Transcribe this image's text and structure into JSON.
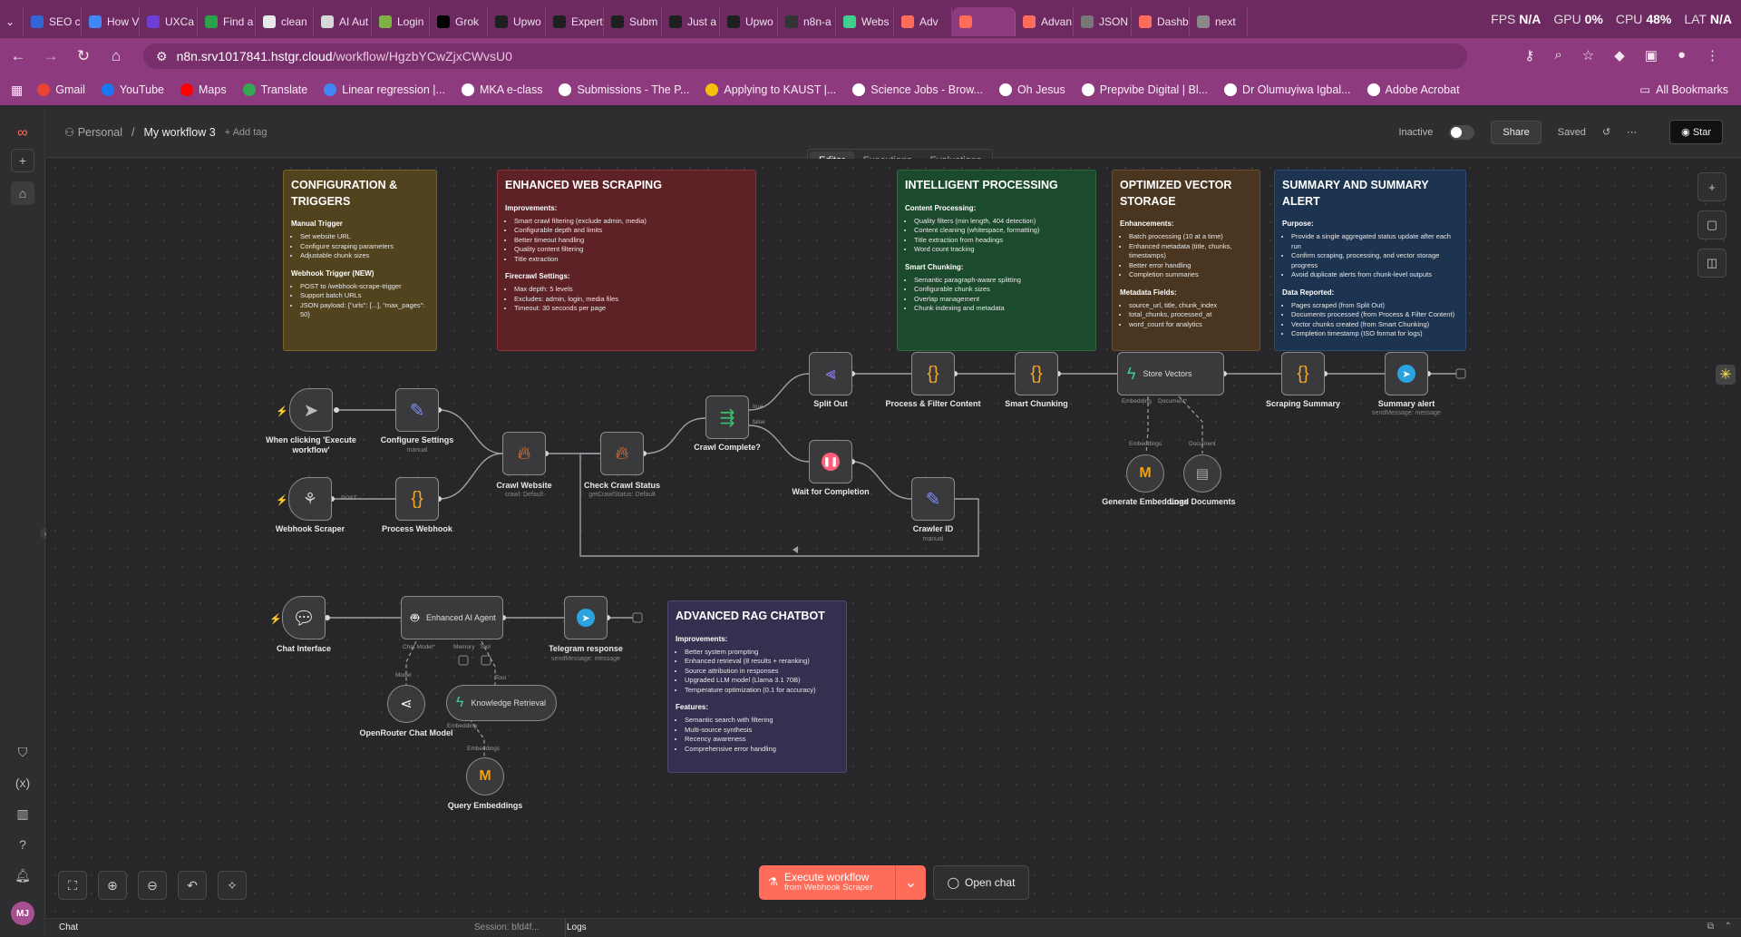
{
  "browser": {
    "tabs": [
      "SEO c",
      "How V",
      "UXCa",
      "Find a",
      "clean",
      "AI Aut",
      "Login",
      "Grok",
      "Upwo",
      "Expert",
      "Subm",
      "Just a",
      "Upwo",
      "n8n-a",
      "Webs",
      "Adv",
      "",
      "Advan",
      "JSON",
      "Dashb",
      "next"
    ],
    "url_host": "n8n.srv1017841.hstgr.cloud",
    "url_path": "/workflow/HgzbYCwZjxCWvsU0",
    "bookmarks": [
      "Gmail",
      "YouTube",
      "Maps",
      "Translate",
      "Linear regression |...",
      "MKA e-class",
      "Submissions - The P...",
      "Applying to KAUST |...",
      "Science Jobs - Brow...",
      "Oh Jesus",
      "Prepvibe Digital | Bl...",
      "Dr Olumuyiwa Igbal...",
      "Adobe Acrobat"
    ],
    "all_bookmarks": "All Bookmarks"
  },
  "hud": {
    "fps_label": "FPS",
    "fps": "N/A",
    "gpu_label": "GPU",
    "gpu": "0%",
    "cpu_label": "CPU",
    "cpu": "48%",
    "lat_label": "LAT",
    "lat": "N/A"
  },
  "header": {
    "project": "Personal",
    "workflow_name": "My workflow 3",
    "add_tag": "+ Add tag",
    "status": "Inactive",
    "share": "Share",
    "saved": "Saved",
    "star": "Star"
  },
  "mode_tabs": [
    "Editor",
    "Executions",
    "Evaluations"
  ],
  "notes": {
    "config": {
      "title": "CONFIGURATION & TRIGGERS",
      "h1": "Manual Trigger",
      "l1": [
        "Set website URL",
        "Configure scraping parameters",
        "Adjustable chunk sizes"
      ],
      "h2": "Webhook Trigger (NEW)",
      "l2": [
        "POST to /webhook-scrape-trigger",
        "Support batch URLs",
        "JSON payload: {\"urls\": [...], \"max_pages\": 50}"
      ]
    },
    "scraping": {
      "title": "ENHANCED WEB SCRAPING",
      "h1": "Improvements:",
      "l1": [
        "Smart crawl filtering (exclude admin, media)",
        "Configurable depth and limits",
        "Better timeout handling",
        "Quality content filtering",
        "Title extraction"
      ],
      "h2": "Firecrawl Settings:",
      "l2": [
        "Max depth: 5 levels",
        "Excludes: admin, login, media files",
        "Timeout: 30 seconds per page"
      ]
    },
    "processing": {
      "title": "INTELLIGENT PROCESSING",
      "h1": "Content Processing:",
      "l1": [
        "Quality filters (min length, 404 detection)",
        "Content cleaning (whitespace, formatting)",
        "Title extraction from headings",
        "Word count tracking"
      ],
      "h2": "Smart Chunking:",
      "l2": [
        "Semantic paragraph-aware splitting",
        "Configurable chunk sizes",
        "Overlap management",
        "Chunk indexing and metadata"
      ]
    },
    "vector": {
      "title": "OPTIMIZED VECTOR STORAGE",
      "h1": "Enhancements:",
      "l1": [
        "Batch processing (10 at a time)",
        "Enhanced metadata (title, chunks, timestamps)",
        "Better error handling",
        "Completion summaries"
      ],
      "h2": "Metadata Fields:",
      "l2": [
        "source_url, title, chunk_index",
        "total_chunks, processed_at",
        "word_count for analytics"
      ]
    },
    "summary": {
      "title": "SUMMARY AND SUMMARY ALERT",
      "h1": "Purpose:",
      "l1": [
        "Provide a single aggregated status update after each run",
        "Confirm scraping, processing, and vector storage progress",
        "Avoid duplicate alerts from chunk-level outputs"
      ],
      "h2": "Data Reported:",
      "l2": [
        "Pages scraped (from Split Out)",
        "Documents processed (from Process & Filter Content)",
        "Vector chunks created (from Smart Chunking)",
        "Completion timestamp (ISO format for logs)"
      ]
    },
    "rag": {
      "title": "ADVANCED RAG CHATBOT",
      "h1": "Improvements:",
      "l1": [
        "Better system prompting",
        "Enhanced retrieval (8 results + reranking)",
        "Source attribution in responses",
        "Upgraded LLM model (Llama 3.1 70B)",
        "Temperature optimization (0.1 for accuracy)"
      ],
      "h2": "Features:",
      "l2": [
        "Semantic search with filtering",
        "Multi-source synthesis",
        "Recency awareness",
        "Comprehensive error handling"
      ]
    }
  },
  "nodes": {
    "manual_trigger": {
      "label": "When clicking 'Execute workflow'"
    },
    "configure": {
      "label": "Configure Settings",
      "sub": "manual"
    },
    "webhook": {
      "label": "Webhook Scraper",
      "port": "POST"
    },
    "process_webhook": {
      "label": "Process Webhook"
    },
    "crawl_website": {
      "label": "Crawl Website",
      "sub": "crawl: Default"
    },
    "check_status": {
      "label": "Check Crawl Status",
      "sub": "getCrawlStatus: Default"
    },
    "crawl_complete": {
      "label": "Crawl Complete?",
      "true": "true",
      "false": "false"
    },
    "split_out": {
      "label": "Split Out"
    },
    "wait": {
      "label": "Wait for Completion"
    },
    "crawler_id": {
      "label": "Crawler ID",
      "sub": "manual"
    },
    "process_filter": {
      "label": "Process & Filter Content"
    },
    "smart_chunking": {
      "label": "Smart Chunking"
    },
    "store_vectors": {
      "label": "Store Vectors",
      "port_a": "Embedding",
      "port_b": "Document*"
    },
    "gen_embeddings": {
      "label": "Generate Embeddings",
      "port": "Embeddings"
    },
    "load_docs": {
      "label": "Load Documents",
      "port": "Document"
    },
    "scraping_summary": {
      "label": "Scraping Summary"
    },
    "summary_alert": {
      "label": "Summary alert",
      "sub": "sendMessage: message"
    },
    "chat_interface": {
      "label": "Chat Interface"
    },
    "ai_agent": {
      "label": "Enhanced AI Agent",
      "p1": "Chat Model*",
      "p2": "Memory",
      "p3": "Tool"
    },
    "telegram": {
      "label": "Telegram response",
      "sub": "sendMessage: message"
    },
    "openrouter": {
      "label": "OpenRouter Chat Model",
      "port": "Model"
    },
    "knowledge": {
      "label": "Knowledge Retrieval",
      "port_top": "Tool",
      "port_bottom": "Embedding"
    },
    "query_emb": {
      "label": "Query Embeddings",
      "port": "Embeddings"
    }
  },
  "footer": {
    "execute": "Execute workflow",
    "execute_sub": "from Webhook Scraper",
    "open_chat": "Open chat",
    "chat": "Chat",
    "session": "Session: bfd4f...",
    "logs": "Logs"
  },
  "colors": {
    "brand": "#ff6d5a",
    "tabbar": "#6d2a60",
    "addr": "#8e3a7f"
  }
}
